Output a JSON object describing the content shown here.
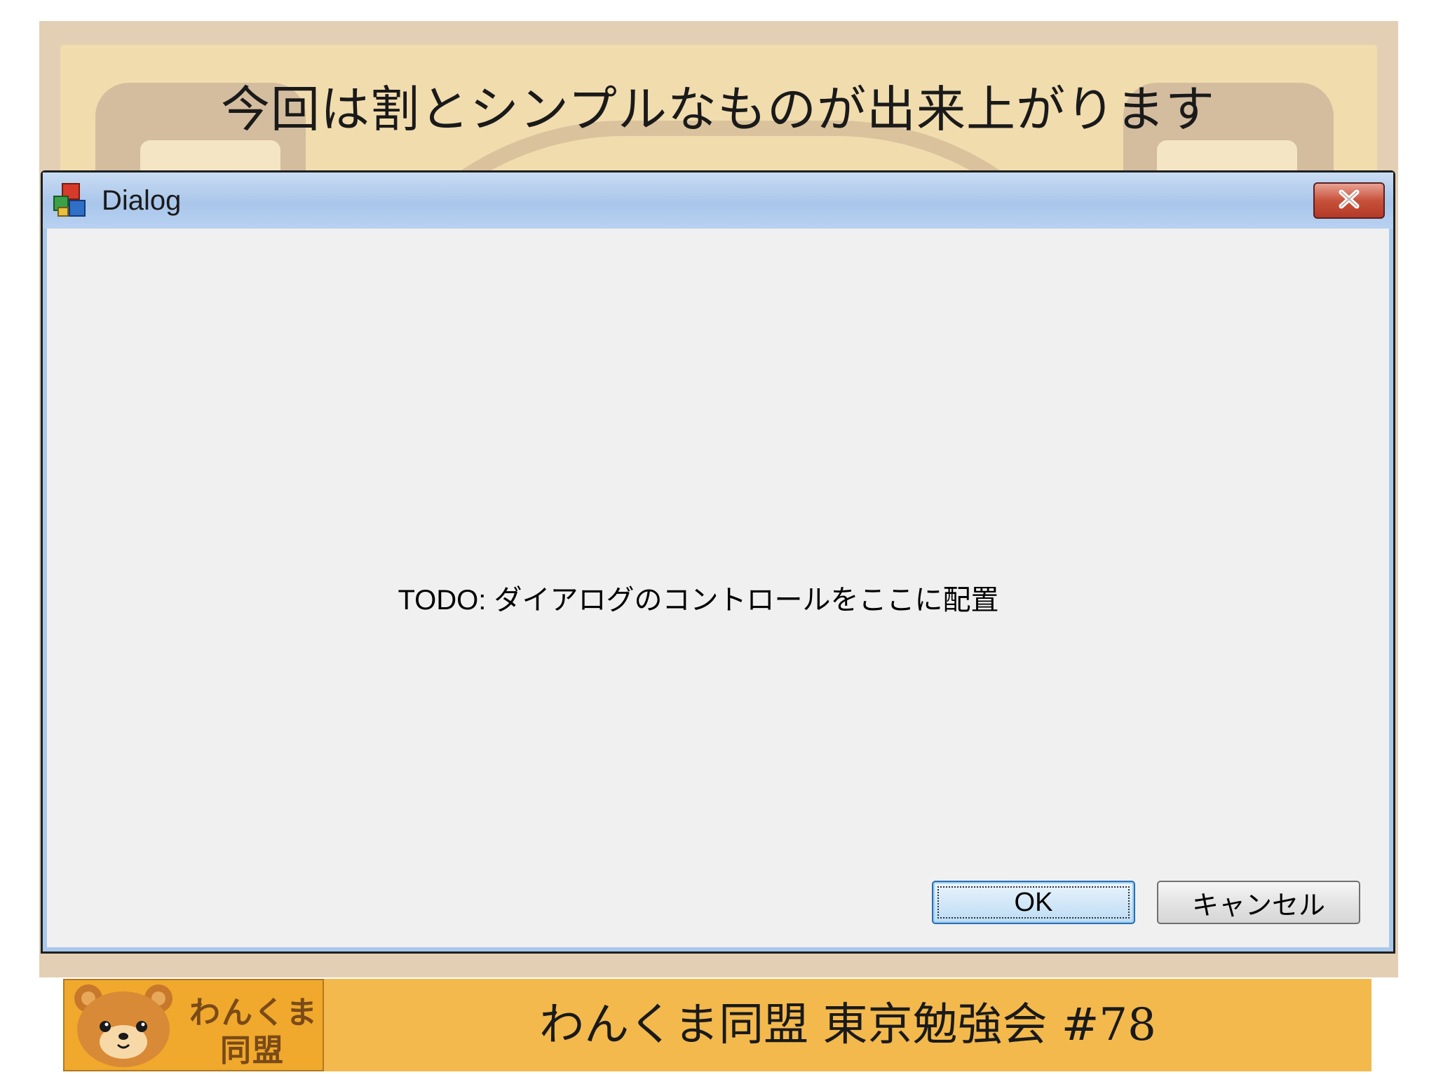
{
  "slide": {
    "title": "今回は割とシンプルなものが出来上がります",
    "footer_text": "わんくま同盟 東京勉強会 #78",
    "logo_line1": "わんくま",
    "logo_line2": "同盟"
  },
  "dialog": {
    "title": "Dialog",
    "close_icon": "close-icon",
    "app_icon": "application-icon",
    "todo_text": "TODO: ダイアログのコントロールをここに配置",
    "ok_label": "OK",
    "cancel_label": "キャンセル"
  },
  "colors": {
    "footer_bg": "#f3b94d",
    "titlebar": "#a9c6ea",
    "close_button": "#c8523c",
    "client_bg": "#f0f0f0"
  }
}
